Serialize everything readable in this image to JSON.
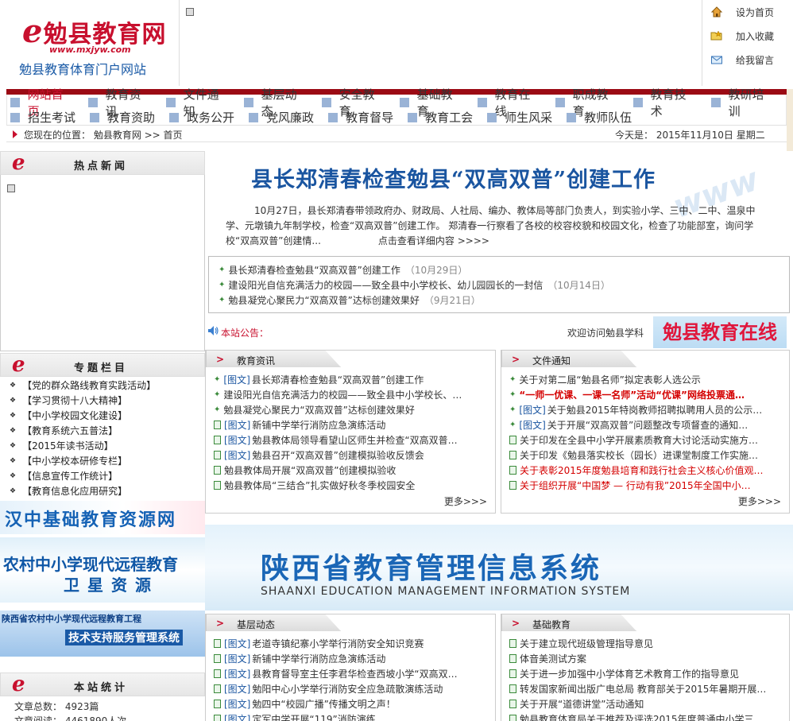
{
  "header": {
    "brand_e": "e",
    "brand_name": "勉县教育网",
    "brand_url": "www.mxjyw.com",
    "brand_subtitle": "勉县教育体育门户网站",
    "quick_links": [
      {
        "label": "设为首页"
      },
      {
        "label": "加入收藏"
      },
      {
        "label": "给我留言"
      }
    ]
  },
  "nav": {
    "row1": [
      "网站首页",
      "教育资讯",
      "文件通知",
      "基层动态",
      "安全教育",
      "基础教育",
      "教育在线",
      "职成教育",
      "教育技术",
      "教研培训"
    ],
    "row2": [
      "招生考试",
      "教育资助",
      "政务公开",
      "党风廉政",
      "教育督导",
      "教育工会",
      "师生风采",
      "教师队伍"
    ],
    "active": "网站首页"
  },
  "location": {
    "text": "您现在的位置：  勉县教育网 >> 首页",
    "date": "今天是：  2015年11月10日  星期二"
  },
  "left": {
    "hot_title": "热点新闻",
    "topics_title": "专题栏目",
    "topics": [
      "【党的群众路线教育实践活动】",
      "【学习贯彻十八大精神】",
      "【中小学校园文化建设】",
      "【教育系统六五普法】",
      "【2015年读书活动】",
      "【中小学校本研修专栏】",
      "【信息宣传工作统计】",
      "【教育信息化应用研究】"
    ],
    "ad1": "汉中基础教育资源网",
    "ad2_line1": "农村中小学现代远程教育",
    "ad2_line2": "卫星资源",
    "ad3_line1": "陕西省农村中小学现代远程教育工程",
    "ad3_line2": "技术支持服务管理系统",
    "stats_title": "本站统计",
    "stats": [
      "文章总数：  4923篇",
      "文章阅读：  4461890人次"
    ]
  },
  "headline": {
    "title": "县长郑清春检查勉县“双高双普”创建工作",
    "summary": "10月27日，县长郑清春带领政府办、财政局、人社局、编办、教体局等部门负责人，到实验小学、三中、二中、温泉中学、元墩镇九年制学校，检查“双高双普”创建工作。  郑清春一行察看了各校的校容校貌和校园文化，检查了功能部室，询问学校“双高双普”创建情...",
    "more": "点击查看详细内容 >>>>",
    "top_links": [
      {
        "title": "县长郑清春检查勉县“双高双普”创建工作",
        "date": "（10月29日）"
      },
      {
        "title": "建设阳光自信充满活力的校园——致全县中小学校长、幼儿园园长的一封信",
        "date": "（10月14日）"
      },
      {
        "title": "勉县凝党心聚民力“双高双普”达标创建效果好",
        "date": "（9月21日）"
      }
    ]
  },
  "notice": {
    "label": "本站公告：",
    "welcome": "欢迎访问勉县学科",
    "online_banner": "勉县教育在线"
  },
  "panels": {
    "edu": {
      "title": "教育资讯",
      "more": "更多>>>",
      "items": [
        {
          "tag": "[图文]",
          "text": "县长郑清春检查勉县“双高双普”创建工作",
          "icon": "star"
        },
        {
          "tag": "",
          "text": "建设阳光自信充满活力的校园——致全县中小学校长、…",
          "icon": "star"
        },
        {
          "tag": "",
          "text": "勉县凝党心聚民力“双高双普”达标创建效果好",
          "icon": "star"
        },
        {
          "tag": "[图文]",
          "text": "新铺中学举行消防应急演练活动",
          "icon": "doc"
        },
        {
          "tag": "[图文]",
          "text": "勉县教体局领导看望山区师生并检查“双高双普…",
          "icon": "doc"
        },
        {
          "tag": "[图文]",
          "text": "勉县召开“双高双普”创建模拟验收反馈会",
          "icon": "doc"
        },
        {
          "tag": "",
          "text": "勉县教体局开展“双高双普”创建模拟验收",
          "icon": "doc"
        },
        {
          "tag": "",
          "text": "勉县教体局“三结合”扎实做好秋冬季校园安全",
          "icon": "doc"
        }
      ]
    },
    "file": {
      "title": "文件通知",
      "more": "更多>>>",
      "items": [
        {
          "tag": "",
          "text": "关于对第二届“勉县名师”拟定表彰人选公示",
          "icon": "star",
          "style": ""
        },
        {
          "tag": "",
          "text": "“一师一优课、一课一名师”活动“优课”网络投票通…",
          "icon": "star",
          "style": "redb"
        },
        {
          "tag": "[图文]",
          "text": "关于勉县2015年特岗教师招聘拟聘用人员的公示…",
          "icon": "star",
          "style": ""
        },
        {
          "tag": "[图文]",
          "text": "关于开展“双高双普”问题整改专项督查的通知…",
          "icon": "star",
          "style": ""
        },
        {
          "tag": "",
          "text": "关于印发在全县中小学开展素质教育大讨论活动实施方…",
          "icon": "doc",
          "style": ""
        },
        {
          "tag": "",
          "text": "关于印发《勉县落实校长（园长）进课堂制度工作实施…",
          "icon": "doc",
          "style": ""
        },
        {
          "tag": "",
          "text": "关于表彰2015年度勉县培育和践行社会主义核心价值观…",
          "icon": "doc",
          "style": "red"
        },
        {
          "tag": "",
          "text": "关于组织开展“中国梦  —  行动有我”2015年全国中小…",
          "icon": "doc",
          "style": "red"
        }
      ]
    },
    "base": {
      "title": "基层动态",
      "items": [
        {
          "tag": "[图文]",
          "text": "老道寺镇纪寨小学举行消防安全知识竞赛"
        },
        {
          "tag": "[图文]",
          "text": "新铺中学举行消防应急演练活动"
        },
        {
          "tag": "[图文]",
          "text": "县教育督导室主任李君华检查西坡小学“双高双…"
        },
        {
          "tag": "[图文]",
          "text": "勉阳中心小学举行消防安全应急疏散演练活动"
        },
        {
          "tag": "[图文]",
          "text": "勉四中“校园广播”传播文明之声！"
        },
        {
          "tag": "[图文]",
          "text": "定军中学开展“119”消防演练"
        }
      ]
    },
    "basic": {
      "title": "基础教育",
      "items": [
        {
          "text": "关于建立现代班级管理指导意见"
        },
        {
          "text": "体音美测试方案"
        },
        {
          "text": "关于进一步加强中小学体育艺术教育工作的指导意见"
        },
        {
          "text": "转发国家新闻出版广电总局 教育部关于2015年暑期开展…"
        },
        {
          "text": "关于开展“道德讲堂”活动通知"
        },
        {
          "text": "勉县教育体育局关于推荐及评选2015年度普通中小学三…"
        }
      ]
    }
  },
  "big_banner": {
    "title": "陕西省教育管理信息系统",
    "subtitle": "SHAANXI EDUCATION MANAGEMENT INFORMATION SYSTEM"
  },
  "colors": {
    "accent_red": "#c8102e",
    "dark_red_bar": "#9b0a14",
    "brand_blue": "#1a55a0"
  }
}
